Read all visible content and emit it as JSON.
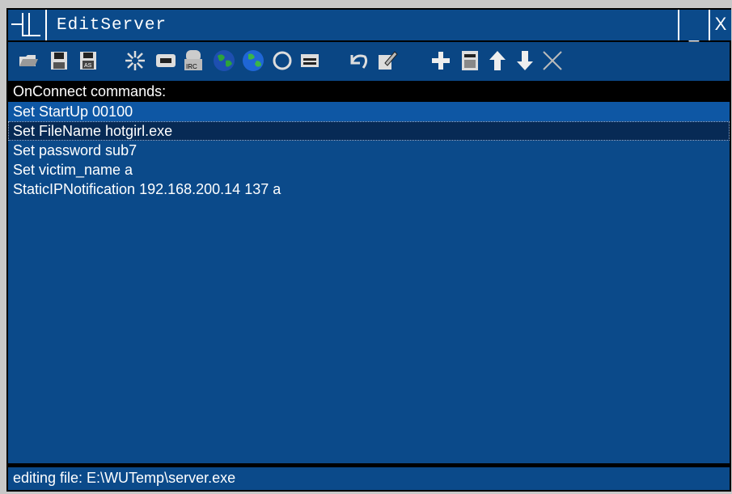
{
  "window": {
    "title": "EditServer",
    "minimize_label": "_",
    "close_label": "X"
  },
  "toolbar": {
    "icons": [
      "open-folder-icon",
      "save-icon",
      "save-as-icon",
      "settings-burst-icon",
      "card-icon",
      "irc-icon",
      "globe-green-icon",
      "globe-blue-icon",
      "circle-icon",
      "window-icon",
      "undo-icon",
      "edit-icon",
      "add-icon",
      "calculator-icon",
      "up-arrow-icon",
      "down-arrow-icon",
      "delete-icon"
    ]
  },
  "list": {
    "header": "OnConnect commands:",
    "items": [
      "Set StartUp 00100",
      "Set FileName hotgirl.exe",
      "Set password sub7",
      "Set victim_name a",
      "StaticIPNotification 192.168.200.14 137 a"
    ]
  },
  "status": {
    "text": "editing file: E:\\WUTemp\\server.exe"
  },
  "colors": {
    "background": "#0b4a8a",
    "selected": "#0e57a4",
    "focused": "#072a55",
    "header": "#000000",
    "text": "#ffffff"
  }
}
